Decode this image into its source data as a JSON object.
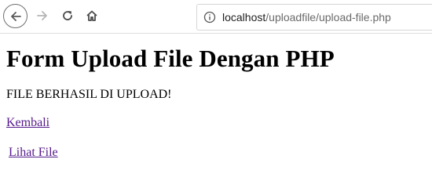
{
  "browser": {
    "url_host": "localhost",
    "url_path": "/uploadfile/upload-file.php",
    "icons": {
      "back": "back-arrow-icon",
      "forward": "forward-arrow-icon",
      "reload": "reload-icon",
      "home": "home-icon",
      "info": "info-icon"
    }
  },
  "page": {
    "title": "Form Upload File Dengan PHP",
    "message": "FILE BERHASIL DI UPLOAD!",
    "link_back": "Kembali",
    "link_view": "Lihat File"
  }
}
